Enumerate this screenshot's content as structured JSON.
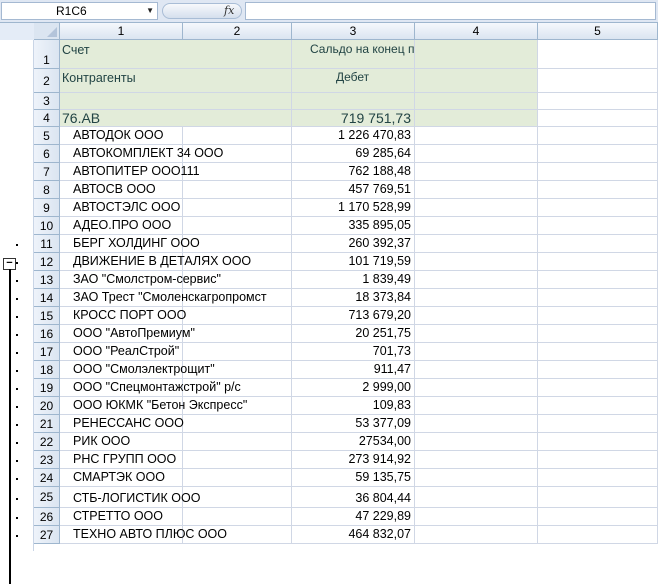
{
  "formula_bar": {
    "name_box": "R1C6",
    "fx_label": "fx",
    "formula": ""
  },
  "outline_levels": [
    "1",
    "2"
  ],
  "columns": [
    "1",
    "2",
    "3",
    "4",
    "5"
  ],
  "header": {
    "r1_a": "Счет",
    "r1_c": "Сальдо на конец периода",
    "r2_a": "Контрагенты",
    "r2_c": "Дебет"
  },
  "rows": [
    {
      "num": "1"
    },
    {
      "num": "2"
    },
    {
      "num": "3"
    },
    {
      "num": "4",
      "name": "76.АВ",
      "value": "719 751,73"
    },
    {
      "num": "5",
      "name": "АВТОДОК ООО",
      "value": "1 226 470,83"
    },
    {
      "num": "6",
      "name": "АВТОКОМПЛЕКТ 34 ООО",
      "value": "69 285,64"
    },
    {
      "num": "7",
      "name": "АВТОПИТЕР ООО111",
      "value": "762 188,48"
    },
    {
      "num": "8",
      "name": "АВТОСВ ООО",
      "value": "457 769,51"
    },
    {
      "num": "9",
      "name": "АВТОСТЭЛС ООО",
      "value": "1 170 528,99"
    },
    {
      "num": "10",
      "name": "АДЕО.ПРО ООО",
      "value": "335 895,05"
    },
    {
      "num": "11",
      "name": "БЕРГ ХОЛДИНГ ООО",
      "value": "260 392,37"
    },
    {
      "num": "12",
      "name": "ДВИЖЕНИЕ В ДЕТАЛЯХ ООО",
      "value": "101 719,59"
    },
    {
      "num": "13",
      "name": "ЗАО \"Смолстром-сервис\"",
      "value": "1 839,49"
    },
    {
      "num": "14",
      "name": "ЗАО Трест \"Смоленскагропромст",
      "value": "18 373,84"
    },
    {
      "num": "15",
      "name": "КРОСС ПОРТ ООО",
      "value": "713 679,20"
    },
    {
      "num": "16",
      "name": "ООО \"АвтоПремиум\"",
      "value": "20 251,75"
    },
    {
      "num": "17",
      "name": "ООО \"РеалСтрой\"",
      "value": "701,73"
    },
    {
      "num": "18",
      "name": "ООО \"Смолэлектрощит\"",
      "value": "911,47"
    },
    {
      "num": "19",
      "name": "ООО \"Спецмонтажстрой\" р/с",
      "value": "2 999,00"
    },
    {
      "num": "20",
      "name": "ООО ЮКМК \"Бетон Экспресс\"",
      "value": "109,83"
    },
    {
      "num": "21",
      "name": "РЕНЕССАНС ООО",
      "value": "53 377,09"
    },
    {
      "num": "22",
      "name": "РИК ООО",
      "value": "27534,00"
    },
    {
      "num": "23",
      "name": "РНС ГРУПП ООО",
      "value": "273 914,92"
    },
    {
      "num": "24",
      "name": "СМАРТЭК ООО",
      "value": "59 135,75"
    },
    {
      "num": "25",
      "name": "СТБ-ЛОГИСТИК ООО",
      "value": "36 804,44"
    },
    {
      "num": "26",
      "name": "СТРЕТТО ООО",
      "value": "47 229,89"
    },
    {
      "num": "27",
      "name": "ТЕХНО АВТО ПЛЮС ООО",
      "value": "464 832,07"
    }
  ],
  "colors": {
    "header_fill": "#e3ecd9",
    "grid": "#d0d7e5",
    "header_bar": "#dbe5f1"
  }
}
